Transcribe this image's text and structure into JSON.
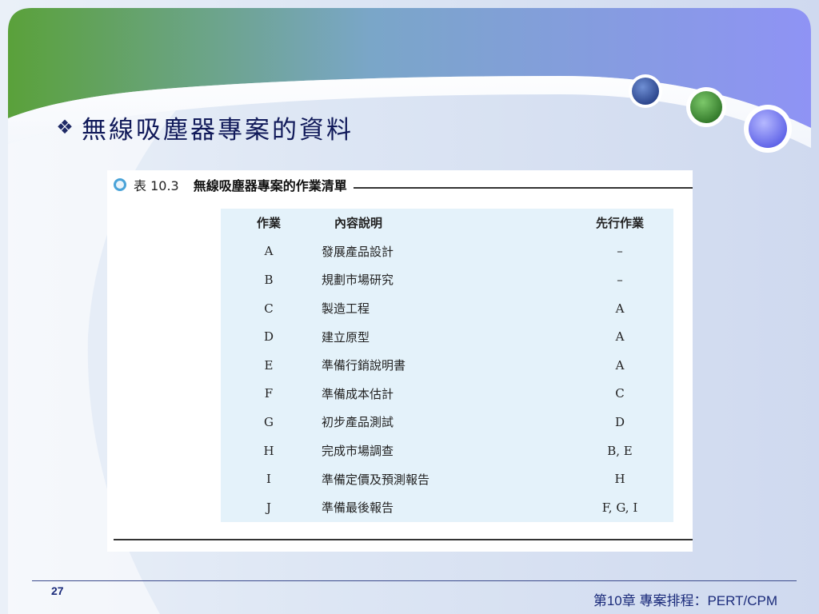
{
  "slide": {
    "title": "無線吸塵器專案的資料",
    "bullet_icon": "diamond-bullet-icon"
  },
  "figure": {
    "caption_label": "表 10.3",
    "caption_title": "無線吸塵器專案的作業清單",
    "columns": [
      "作業",
      "內容說明",
      "先行作業"
    ],
    "rows": [
      {
        "activity": "A",
        "description": "發展產品設計",
        "predecessors": "–"
      },
      {
        "activity": "B",
        "description": "規劃市場研究",
        "predecessors": "–"
      },
      {
        "activity": "C",
        "description": "製造工程",
        "predecessors": "A"
      },
      {
        "activity": "D",
        "description": "建立原型",
        "predecessors": "A"
      },
      {
        "activity": "E",
        "description": "準備行銷說明書",
        "predecessors": "A"
      },
      {
        "activity": "F",
        "description": "準備成本估計",
        "predecessors": "C"
      },
      {
        "activity": "G",
        "description": "初步產品測試",
        "predecessors": "D"
      },
      {
        "activity": "H",
        "description": "完成市場調查",
        "predecessors": "B, E"
      },
      {
        "activity": "I",
        "description": "準備定價及預測報告",
        "predecessors": "H"
      },
      {
        "activity": "J",
        "description": "準備最後報告",
        "predecessors": "F, G, I"
      }
    ]
  },
  "footer": {
    "page_number": "27",
    "chapter_text": "第10章 專案排程：PERT/CPM"
  },
  "colors": {
    "title": "#111a5a",
    "table_panel": "#e4f2fa",
    "band_green": "#5a9e3c",
    "band_purple": "#8a8ff0",
    "circle_blue": "#2f4f99",
    "circle_green": "#3f8a32",
    "circle_violet": "#6a6ff0"
  }
}
